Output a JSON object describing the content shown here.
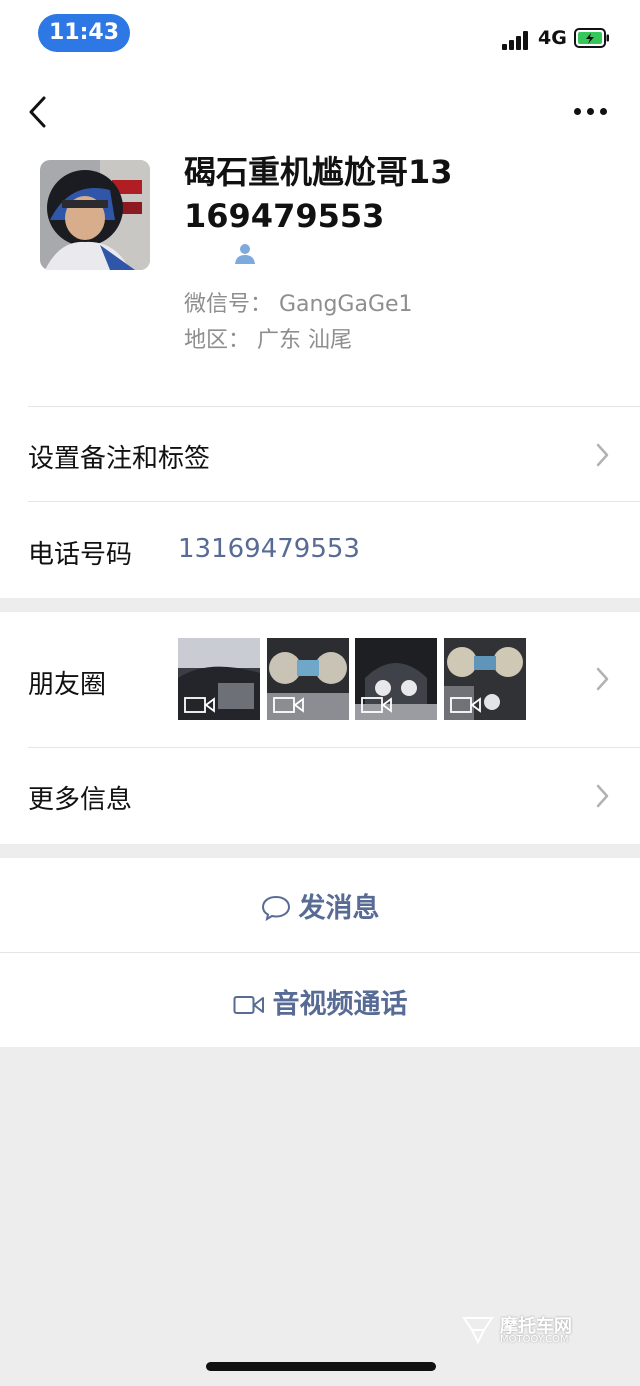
{
  "status_bar": {
    "time": "11:43",
    "network": "4G",
    "accent_color": "#2d78e4",
    "battery_color": "#35c759"
  },
  "nav": {
    "back_icon": "chevron-left-icon",
    "more_icon": "ellipsis-icon"
  },
  "profile": {
    "name": "碣石重机尴尬哥13169479553",
    "wechat_id": "微信号：  GangGaGe1",
    "region": "地区：  广东  汕尾"
  },
  "rows": {
    "remark_label": "设置备注和标签",
    "phone_label": "电话号码",
    "phone_value": "13169479553",
    "moments_label": "朋友圈",
    "more_info_label": "更多信息"
  },
  "actions": {
    "message": "发消息",
    "video_call": "音视频通话"
  },
  "watermark": {
    "text": "摩托车网",
    "subtext": "MOTOOY.COM"
  },
  "colors": {
    "link": "#576b95",
    "background": "#ededed"
  }
}
